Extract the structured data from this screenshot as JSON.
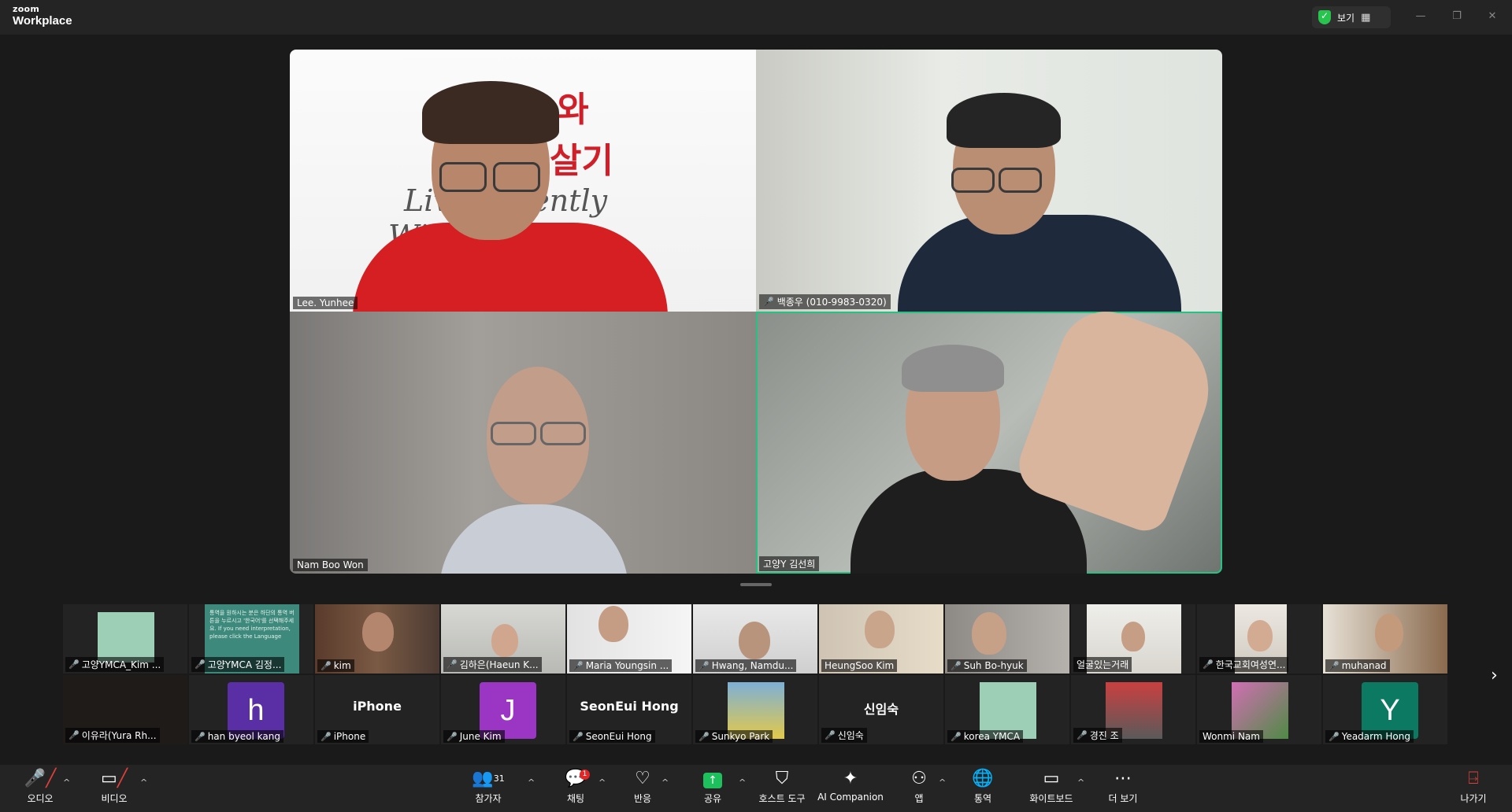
{
  "app": {
    "brand_small": "zoom",
    "brand_big": "Workplace",
    "view_label": "보기"
  },
  "window_controls": {
    "minimize": "—",
    "restore": "❐",
    "close": "✕"
  },
  "main_tiles": [
    {
      "name": "Lee. Yunhee",
      "muted": false,
      "bg_text_1": "YMCA와",
      "bg_text_2": "살기",
      "bg_text_3": "Living Gently",
      "bg_text_4": "With YMCA"
    },
    {
      "name": "백종우 (010-9983-0320)",
      "muted": true
    },
    {
      "name": "Nam Boo Won",
      "muted": false
    },
    {
      "name": "고양Y 김선희",
      "muted": false,
      "active": true
    }
  ],
  "thumbnails_row1": [
    {
      "name": "고양YMCA_Kim ...",
      "muted": true
    },
    {
      "name": "고양YMCA 김정...",
      "muted": true,
      "inner_text": "통역을 원하시는 분은 하단의 통역 버튼을 누르시고 '한국어'를 선택해주세요. If you need interpretation, please click the Language"
    },
    {
      "name": "kim",
      "muted": true
    },
    {
      "name": "김하은(Haeun K...",
      "muted": true
    },
    {
      "name": "Maria Youngsin ...",
      "muted": true
    },
    {
      "name": "Hwang, Namdu...",
      "muted": true
    },
    {
      "name": "HeungSoo Kim",
      "muted": false
    },
    {
      "name": "Suh Bo-hyuk",
      "muted": true
    },
    {
      "name": "얼굴있는거래",
      "muted": false
    },
    {
      "name": "한국교회여성연...",
      "muted": true
    },
    {
      "name": "muhanad",
      "muted": true
    }
  ],
  "thumbnails_row2": [
    {
      "name": "이유라(Yura Rh...",
      "muted": true,
      "type": "blank"
    },
    {
      "name": "han byeol kang",
      "muted": true,
      "type": "avatar",
      "letter": "h",
      "color": "#5a2fa6"
    },
    {
      "name": "iPhone",
      "muted": true,
      "type": "text",
      "center": "iPhone"
    },
    {
      "name": "June Kim",
      "muted": true,
      "type": "avatar",
      "letter": "J",
      "color": "#9a35c4"
    },
    {
      "name": "SeonEui Hong",
      "muted": true,
      "type": "text",
      "center": "SeonEui Hong"
    },
    {
      "name": "Sunkyo Park",
      "muted": true,
      "type": "photo"
    },
    {
      "name": "신임숙",
      "muted": true,
      "type": "text",
      "center": "신임숙"
    },
    {
      "name": "korea YMCA",
      "muted": true,
      "type": "photo"
    },
    {
      "name": "경진 조",
      "muted": true,
      "type": "photo"
    },
    {
      "name": "Wonmi Nam",
      "muted": false,
      "type": "photo"
    },
    {
      "name": "Yeadarm Hong",
      "muted": true,
      "type": "avatar",
      "letter": "Y",
      "color": "#0c7a62"
    }
  ],
  "toolbar": {
    "audio": "오디오",
    "video": "비디오",
    "participants": "참가자",
    "participants_count": "31",
    "chat": "채팅",
    "chat_badge": "1",
    "reactions": "반응",
    "share": "공유",
    "host_tools": "호스트 도구",
    "ai_companion": "AI Companion",
    "apps": "앱",
    "interpretation": "통역",
    "whiteboard": "화이트보드",
    "more": "더 보기",
    "leave": "나가기"
  },
  "colors": {
    "active_border": "#26c281",
    "share_green": "#1ec05e",
    "mute_red": "#e0403a",
    "toolbar_bg": "#242424"
  }
}
